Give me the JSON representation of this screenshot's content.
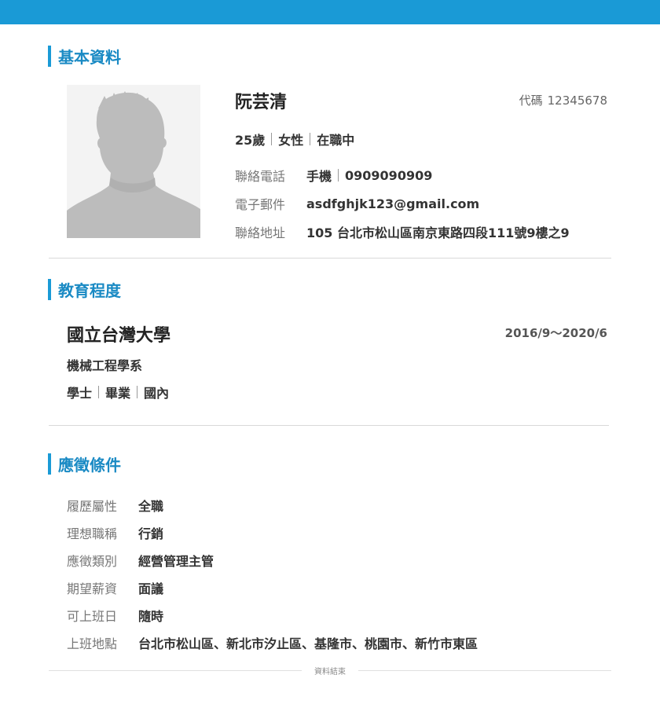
{
  "basic": {
    "section_title": "基本資料",
    "name": "阮芸清",
    "code_label": "代碼",
    "code_value": "12345678",
    "age": "25歲",
    "gender": "女性",
    "status": "在職中",
    "phone_label": "聯絡電話",
    "phone_type": "手機",
    "phone_value": "0909090909",
    "email_label": "電子郵件",
    "email_value": "asdfghjk123@gmail.com",
    "address_label": "聯絡地址",
    "address_value": "105 台北市松山區南京東路四段111號9樓之9",
    "avatar_icon": "person-silhouette-icon"
  },
  "education": {
    "section_title": "教育程度",
    "school": "國立台灣大學",
    "period": "2016/9～2020/6",
    "department": "機械工程學系",
    "degree": "學士",
    "graduation": "畢業",
    "region": "國內"
  },
  "conditions": {
    "section_title": "應徵條件",
    "rows": [
      {
        "label": "履歷屬性",
        "value": "全職"
      },
      {
        "label": "理想職稱",
        "value": "行銷"
      },
      {
        "label": "應徵類別",
        "value": "經營管理主管"
      },
      {
        "label": "期望薪資",
        "value": "面議"
      },
      {
        "label": "可上班日",
        "value": "隨時"
      },
      {
        "label": "上班地點",
        "value": "台北市松山區、新北市汐止區、基隆市、桃園市、新竹市東區"
      }
    ]
  },
  "footer": {
    "end_text": "資料結束"
  },
  "colors": {
    "accent": "#1a9ad6",
    "section_title": "#1a8ac4",
    "label": "#777777",
    "value": "#333333"
  }
}
